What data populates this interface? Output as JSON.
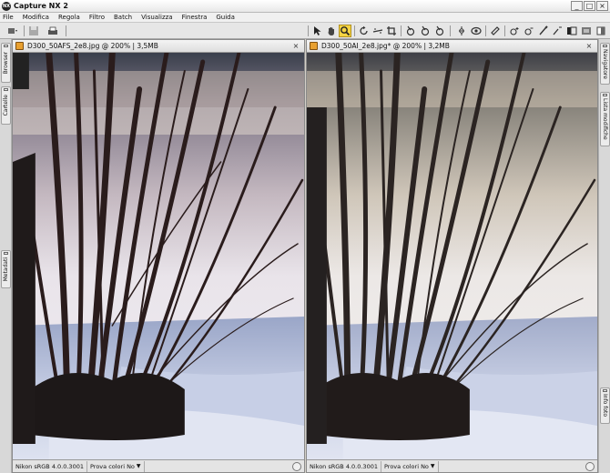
{
  "app": {
    "title": "Capture NX 2",
    "logo_text": "NX"
  },
  "window_controls": [
    "_",
    "□",
    "×"
  ],
  "menu": [
    "File",
    "Modifica",
    "Regola",
    "Filtro",
    "Batch",
    "Visualizza",
    "Finestra",
    "Guida"
  ],
  "left_panel_tabs": [
    "Browser",
    "Cartelle",
    "Metadati"
  ],
  "right_panel_tabs": [
    "Navigatore",
    "Lista modifiche",
    "Info foto"
  ],
  "documents": [
    {
      "title": "D300_50AFS_2e8.jpg @ 200% | 3,5MB",
      "profile": "Nikon sRGB 4.0.0.3001",
      "proof_label": "Prova colori No"
    },
    {
      "title": "D300_50AI_2e8.jpg* @ 200% | 3,2MB",
      "profile": "Nikon sRGB 4.0.0.3001",
      "proof_label": "Prova colori No"
    }
  ],
  "toolbar": {
    "active_tool": "zoom-tool",
    "icons": [
      "save-icon",
      "print-icon",
      "direct-select-icon",
      "hand-icon",
      "zoom-icon",
      "rotate-icon",
      "straighten-icon",
      "crop-icon",
      "black-point-icon",
      "neutral-point-icon",
      "white-point-icon",
      "red-eye-icon",
      "compare-icon",
      "lasso-icon",
      "gradient-icon",
      "brush-icon"
    ]
  }
}
